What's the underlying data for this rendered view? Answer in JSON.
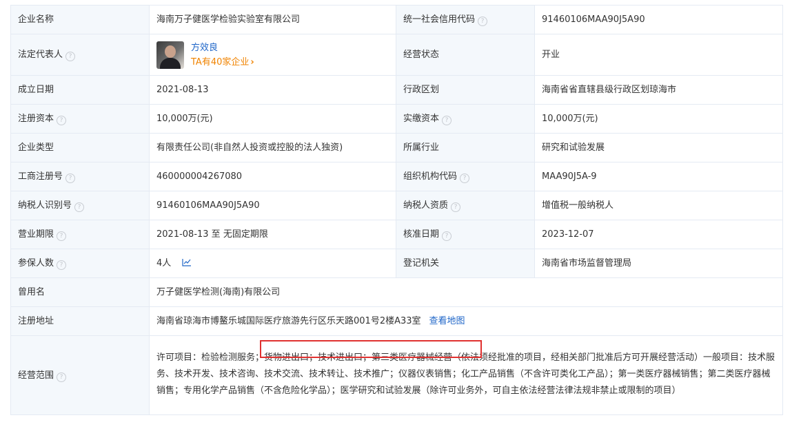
{
  "rows": {
    "r1": {
      "l1": "企业名称",
      "v1": "海南万子健医学检验实验室有限公司",
      "l2": "统一社会信用代码",
      "v2": "91460106MAA90J5A90"
    },
    "r2": {
      "l1": "法定代表人",
      "person_name": "方效良",
      "person_link": "TA有40家企业",
      "l2": "经营状态",
      "v2": "开业"
    },
    "r3": {
      "l1": "成立日期",
      "v1": "2021-08-13",
      "l2": "行政区划",
      "v2": "海南省省直辖县级行政区划琼海市"
    },
    "r4": {
      "l1": "注册资本",
      "v1": "10,000万(元)",
      "l2": "实缴资本",
      "v2": "10,000万(元)"
    },
    "r5": {
      "l1": "企业类型",
      "v1": "有限责任公司(非自然人投资或控股的法人独资)",
      "l2": "所属行业",
      "v2": "研究和试验发展"
    },
    "r6": {
      "l1": "工商注册号",
      "v1": "460000004267080",
      "l2": "组织机构代码",
      "v2": "MAA90J5A-9"
    },
    "r7": {
      "l1": "纳税人识别号",
      "v1": "91460106MAA90J5A90",
      "l2": "纳税人资质",
      "v2": "增值税一般纳税人"
    },
    "r8": {
      "l1": "营业期限",
      "v1": "2021-08-13 至 无固定期限",
      "l2": "核准日期",
      "v2": "2023-12-07"
    },
    "r9": {
      "l1": "参保人数",
      "v1": "4人",
      "l2": "登记机关",
      "v2": "海南省市场监督管理局"
    },
    "r10": {
      "l1": "曾用名",
      "v1": "万子健医学检测(海南)有限公司"
    },
    "r11": {
      "l1": "注册地址",
      "v1": "海南省琼海市博鳌乐城国际医疗旅游先行区乐天路001号2楼A33室",
      "link": "查看地图"
    },
    "r12": {
      "l1": "经营范围",
      "v1": "许可项目：检验检测服务；货物进出口；技术进出口；第三类医疗器械经营（依法须经批准的项目，经相关部门批准后方可开展经营活动）一般项目：技术服务、技术开发、技术咨询、技术交流、技术转让、技术推广；仪器仪表销售；化工产品销售（不含许可类化工产品）；第一类医疗器械销售；第二类医疗器械销售；专用化学产品销售（不含危险化学品）；医学研究和试验发展（除许可业务外，可自主依法经营法律法规非禁止或限制的项目）"
    }
  },
  "help_icon": "question-circle-icon",
  "colors": {
    "label_bg": "#f4f8fc",
    "border": "#e4eaf3",
    "link": "#1f66c8",
    "orange": "#f08300",
    "highlight": "#e0302f"
  }
}
